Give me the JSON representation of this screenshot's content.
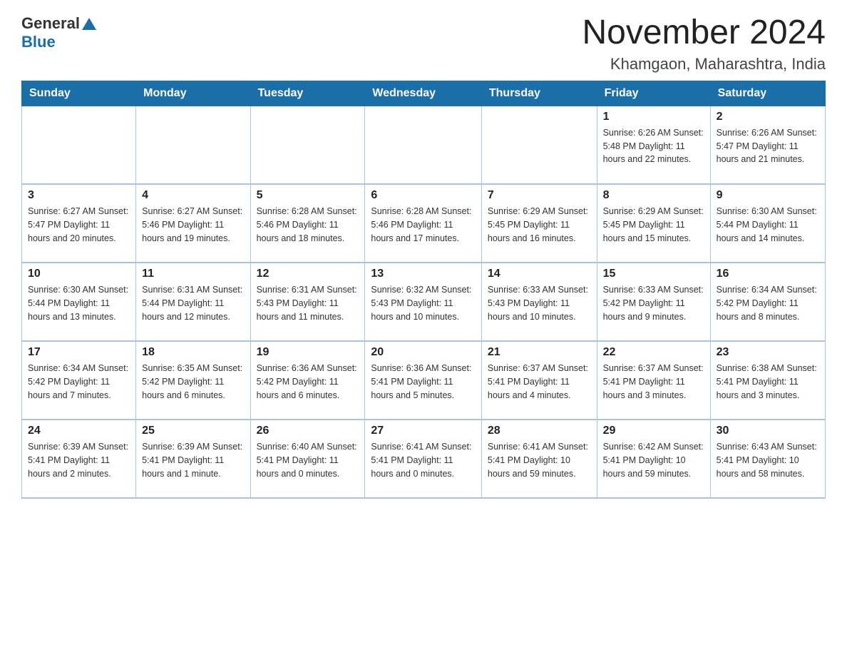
{
  "header": {
    "logo_general": "General",
    "logo_blue": "Blue",
    "title": "November 2024",
    "subtitle": "Khamgaon, Maharashtra, India"
  },
  "weekdays": [
    "Sunday",
    "Monday",
    "Tuesday",
    "Wednesday",
    "Thursday",
    "Friday",
    "Saturday"
  ],
  "weeks": [
    [
      {
        "day": "",
        "details": ""
      },
      {
        "day": "",
        "details": ""
      },
      {
        "day": "",
        "details": ""
      },
      {
        "day": "",
        "details": ""
      },
      {
        "day": "",
        "details": ""
      },
      {
        "day": "1",
        "details": "Sunrise: 6:26 AM\nSunset: 5:48 PM\nDaylight: 11 hours and 22 minutes."
      },
      {
        "day": "2",
        "details": "Sunrise: 6:26 AM\nSunset: 5:47 PM\nDaylight: 11 hours and 21 minutes."
      }
    ],
    [
      {
        "day": "3",
        "details": "Sunrise: 6:27 AM\nSunset: 5:47 PM\nDaylight: 11 hours and 20 minutes."
      },
      {
        "day": "4",
        "details": "Sunrise: 6:27 AM\nSunset: 5:46 PM\nDaylight: 11 hours and 19 minutes."
      },
      {
        "day": "5",
        "details": "Sunrise: 6:28 AM\nSunset: 5:46 PM\nDaylight: 11 hours and 18 minutes."
      },
      {
        "day": "6",
        "details": "Sunrise: 6:28 AM\nSunset: 5:46 PM\nDaylight: 11 hours and 17 minutes."
      },
      {
        "day": "7",
        "details": "Sunrise: 6:29 AM\nSunset: 5:45 PM\nDaylight: 11 hours and 16 minutes."
      },
      {
        "day": "8",
        "details": "Sunrise: 6:29 AM\nSunset: 5:45 PM\nDaylight: 11 hours and 15 minutes."
      },
      {
        "day": "9",
        "details": "Sunrise: 6:30 AM\nSunset: 5:44 PM\nDaylight: 11 hours and 14 minutes."
      }
    ],
    [
      {
        "day": "10",
        "details": "Sunrise: 6:30 AM\nSunset: 5:44 PM\nDaylight: 11 hours and 13 minutes."
      },
      {
        "day": "11",
        "details": "Sunrise: 6:31 AM\nSunset: 5:44 PM\nDaylight: 11 hours and 12 minutes."
      },
      {
        "day": "12",
        "details": "Sunrise: 6:31 AM\nSunset: 5:43 PM\nDaylight: 11 hours and 11 minutes."
      },
      {
        "day": "13",
        "details": "Sunrise: 6:32 AM\nSunset: 5:43 PM\nDaylight: 11 hours and 10 minutes."
      },
      {
        "day": "14",
        "details": "Sunrise: 6:33 AM\nSunset: 5:43 PM\nDaylight: 11 hours and 10 minutes."
      },
      {
        "day": "15",
        "details": "Sunrise: 6:33 AM\nSunset: 5:42 PM\nDaylight: 11 hours and 9 minutes."
      },
      {
        "day": "16",
        "details": "Sunrise: 6:34 AM\nSunset: 5:42 PM\nDaylight: 11 hours and 8 minutes."
      }
    ],
    [
      {
        "day": "17",
        "details": "Sunrise: 6:34 AM\nSunset: 5:42 PM\nDaylight: 11 hours and 7 minutes."
      },
      {
        "day": "18",
        "details": "Sunrise: 6:35 AM\nSunset: 5:42 PM\nDaylight: 11 hours and 6 minutes."
      },
      {
        "day": "19",
        "details": "Sunrise: 6:36 AM\nSunset: 5:42 PM\nDaylight: 11 hours and 6 minutes."
      },
      {
        "day": "20",
        "details": "Sunrise: 6:36 AM\nSunset: 5:41 PM\nDaylight: 11 hours and 5 minutes."
      },
      {
        "day": "21",
        "details": "Sunrise: 6:37 AM\nSunset: 5:41 PM\nDaylight: 11 hours and 4 minutes."
      },
      {
        "day": "22",
        "details": "Sunrise: 6:37 AM\nSunset: 5:41 PM\nDaylight: 11 hours and 3 minutes."
      },
      {
        "day": "23",
        "details": "Sunrise: 6:38 AM\nSunset: 5:41 PM\nDaylight: 11 hours and 3 minutes."
      }
    ],
    [
      {
        "day": "24",
        "details": "Sunrise: 6:39 AM\nSunset: 5:41 PM\nDaylight: 11 hours and 2 minutes."
      },
      {
        "day": "25",
        "details": "Sunrise: 6:39 AM\nSunset: 5:41 PM\nDaylight: 11 hours and 1 minute."
      },
      {
        "day": "26",
        "details": "Sunrise: 6:40 AM\nSunset: 5:41 PM\nDaylight: 11 hours and 0 minutes."
      },
      {
        "day": "27",
        "details": "Sunrise: 6:41 AM\nSunset: 5:41 PM\nDaylight: 11 hours and 0 minutes."
      },
      {
        "day": "28",
        "details": "Sunrise: 6:41 AM\nSunset: 5:41 PM\nDaylight: 10 hours and 59 minutes."
      },
      {
        "day": "29",
        "details": "Sunrise: 6:42 AM\nSunset: 5:41 PM\nDaylight: 10 hours and 59 minutes."
      },
      {
        "day": "30",
        "details": "Sunrise: 6:43 AM\nSunset: 5:41 PM\nDaylight: 10 hours and 58 minutes."
      }
    ]
  ]
}
